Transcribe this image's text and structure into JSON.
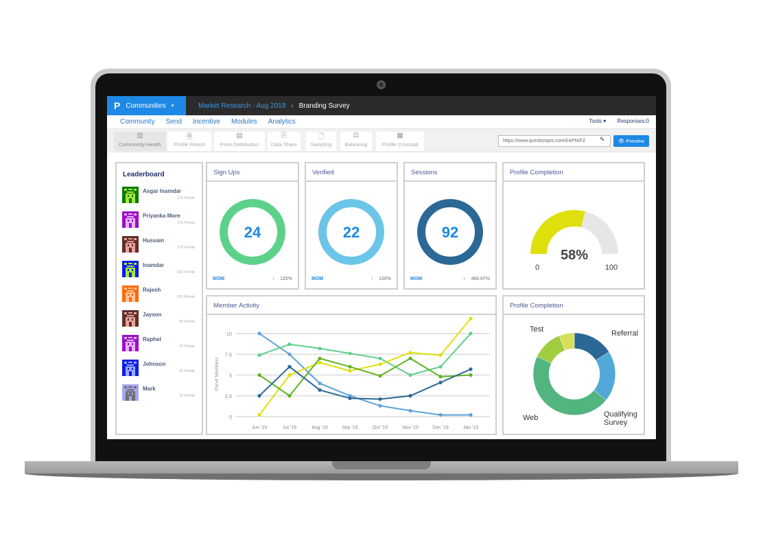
{
  "topbar": {
    "brand": "Communities",
    "brand_caret": "▾",
    "logo": "P",
    "crumb_parent": "Market Research -  Aug 2019",
    "crumb_sep": "›",
    "crumb_current": "Branding Survey"
  },
  "nav": {
    "items": [
      "Community",
      "Send",
      "Incentive",
      "Modules",
      "Analytics"
    ],
    "tools": "Tools ▾",
    "responses": "Responses:0"
  },
  "toolbar": {
    "items": [
      {
        "label": "Community Health",
        "icon": "bar-chart-icon",
        "glyph": "▥",
        "active": true
      },
      {
        "label": "Profile Report",
        "icon": "profile-report-icon",
        "glyph": "🗎"
      },
      {
        "label": "Point Distribution",
        "icon": "document-icon",
        "glyph": "▤"
      },
      {
        "label": "Data Share",
        "icon": "data-share-icon",
        "glyph": "⎘"
      },
      {
        "label": "Sampling",
        "icon": "sampling-icon",
        "glyph": "🗋"
      },
      {
        "label": "Balancing",
        "icon": "balance-icon",
        "glyph": "⚖"
      },
      {
        "label": "Profile Crosstab",
        "icon": "crosstab-icon",
        "glyph": "▦"
      }
    ],
    "url": "https://www.questionpro.com/t/APNIFZ",
    "preview": "Preview"
  },
  "leaderboard": {
    "title": "Leaderboard",
    "items": [
      {
        "name": "Asgar Inamdar",
        "points": "170 Points",
        "bg": "#0a7a0a",
        "fg": "#a8e63a"
      },
      {
        "name": "Priyanka More",
        "points": "170 Points",
        "bg": "#9a10c8",
        "fg": "#e7b4f4"
      },
      {
        "name": "Hussain",
        "points": "170 Points",
        "bg": "#5e2f2a",
        "fg": "#e8a19a"
      },
      {
        "name": "Inamdar",
        "points": "160 Points",
        "bg": "#0a1ee8",
        "fg": "#a8e63a"
      },
      {
        "name": "Rajesh",
        "points": "150 Points",
        "bg": "#ff6a00",
        "fg": "#ffc4a0"
      },
      {
        "name": "Jayson",
        "points": "80 Points",
        "bg": "#5e2f2a",
        "fg": "#e8a19a"
      },
      {
        "name": "Raphel",
        "points": "70 Points",
        "bg": "#9a10c8",
        "fg": "#e7b4f4"
      },
      {
        "name": "Johnson",
        "points": "20 Points",
        "bg": "#0a1ee8",
        "fg": "#a0a8ff"
      },
      {
        "name": "Mark",
        "points": "10 Points",
        "bg": "#a6a6f0",
        "fg": "#6e6e6e"
      }
    ]
  },
  "stats": [
    {
      "title": "Sign Ups",
      "value": "24",
      "color": "#5dd08a",
      "mom": "MOM",
      "change": "120%"
    },
    {
      "title": "Verified",
      "value": "22",
      "color": "#6bc5e8",
      "mom": "MOM",
      "change": "120%"
    },
    {
      "title": "Sessions",
      "value": "92",
      "color": "#2b6896",
      "mom": "MOM",
      "change": "466.67%"
    }
  ],
  "gauge": {
    "title": "Profile Completion",
    "value": 58,
    "label": "58%",
    "min": "0",
    "max": "100",
    "fill": "#dde00d",
    "track": "#e6e6e6"
  },
  "chart_data": [
    {
      "type": "line",
      "title": "Member Activity",
      "ylabel": "Panel Members",
      "ylim": [
        0,
        10
      ],
      "yticks": [
        "0",
        "2.5",
        "5",
        "7.5",
        "10"
      ],
      "grid": true,
      "categories": [
        "Jun '19",
        "Jul '19",
        "Aug '19",
        "Sep '19",
        "Oct '19",
        "Nov '19",
        "Dec '19",
        "Jan '19"
      ],
      "series": [
        {
          "color": "#5ba3d9",
          "values": [
            10,
            7.5,
            4.0,
            2.5,
            1.3,
            0.7,
            0.2,
            0.2
          ]
        },
        {
          "color": "#5dd08a",
          "values": [
            7.4,
            8.7,
            8.2,
            7.6,
            7.0,
            5.0,
            6.0,
            10
          ]
        },
        {
          "color": "#dde00d",
          "values": [
            0.2,
            5.0,
            6.5,
            5.5,
            6.3,
            7.7,
            7.4,
            11.8
          ]
        },
        {
          "color": "#5fb31f",
          "values": [
            5.0,
            2.5,
            7.0,
            6.0,
            4.9,
            7.0,
            4.8,
            5.0
          ]
        },
        {
          "color": "#2b6896",
          "values": [
            2.5,
            6.0,
            3.2,
            2.2,
            2.1,
            2.5,
            4.1,
            5.7
          ]
        }
      ]
    },
    {
      "type": "pie",
      "title": "Profile Completion",
      "donut": true,
      "slices": [
        {
          "label": "Referral",
          "value": 16,
          "color": "#2b6896"
        },
        {
          "label": "Qualifying Survey",
          "value": 20,
          "color": "#52a8d8"
        },
        {
          "label": "Web",
          "value": 46,
          "color": "#52b47e"
        },
        {
          "label": "Test",
          "value": 12,
          "color": "#a0cc40"
        },
        {
          "label": "",
          "value": 6,
          "color": "#d6e05a"
        }
      ]
    }
  ]
}
